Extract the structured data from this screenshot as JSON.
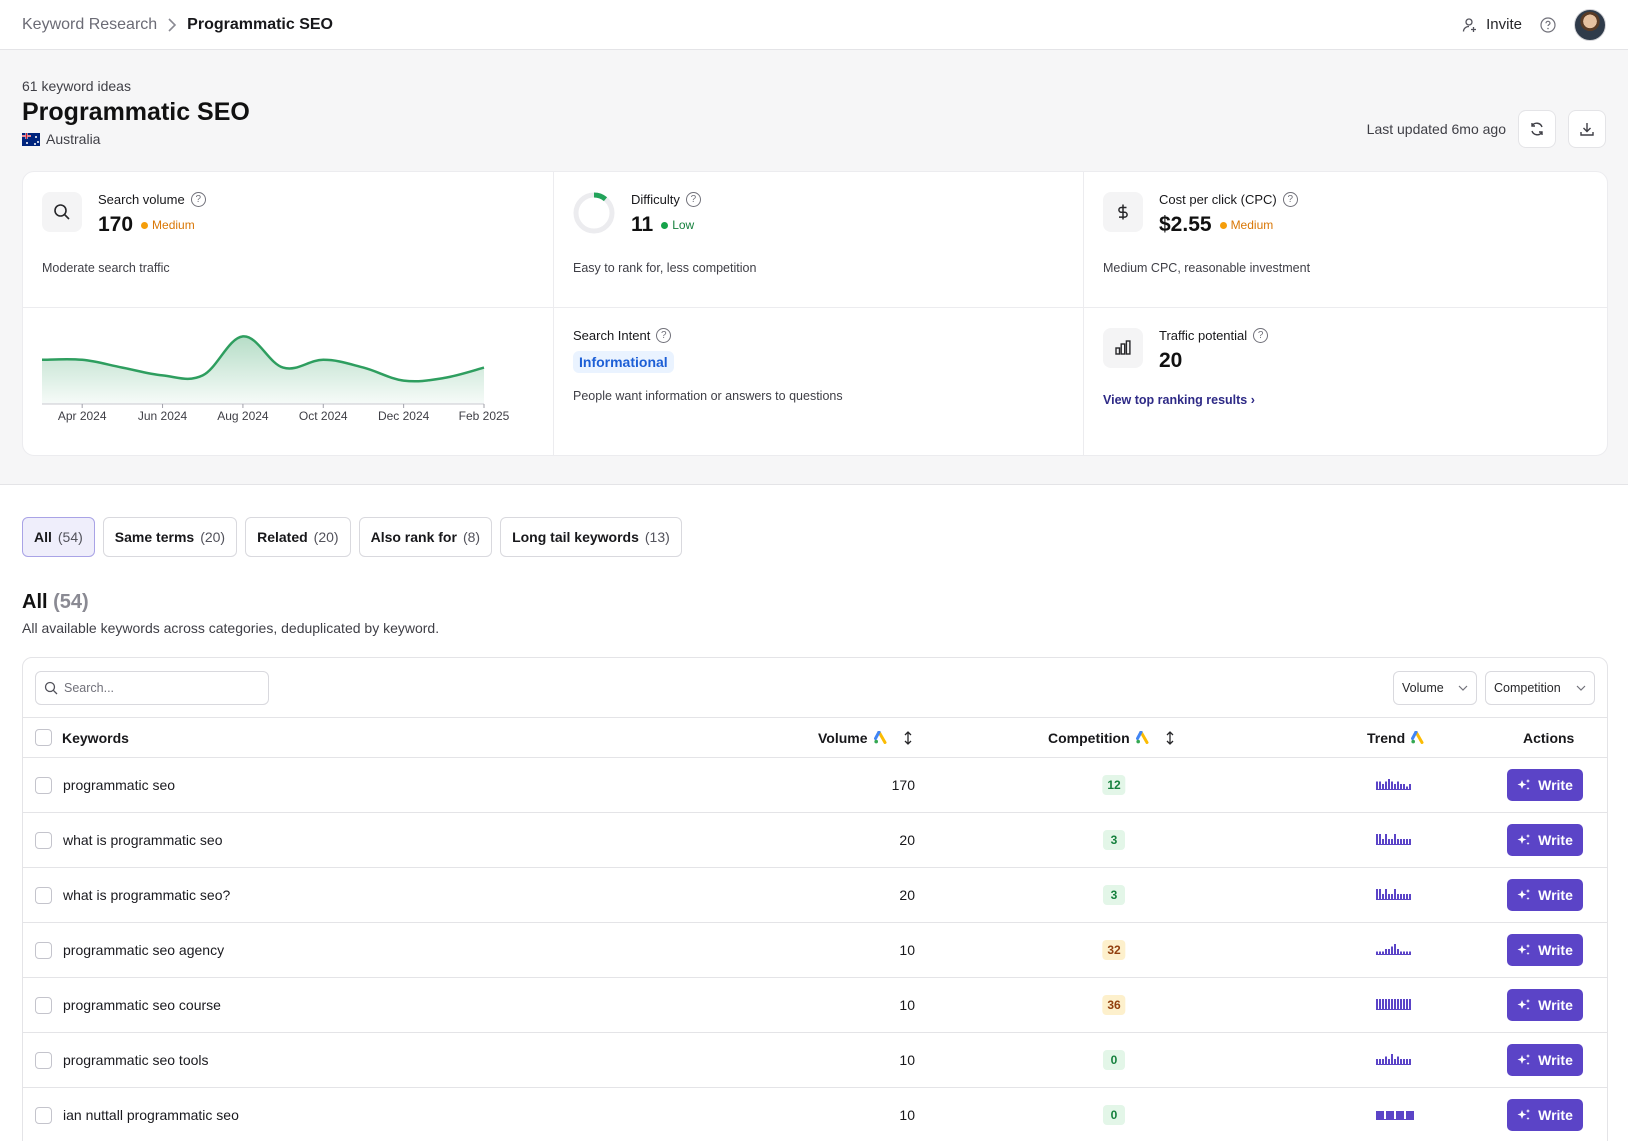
{
  "breadcrumb": {
    "parent": "Keyword Research",
    "current": "Programmatic SEO"
  },
  "topbar": {
    "invite_label": "Invite"
  },
  "header": {
    "idea_count": "61 keyword ideas",
    "title": "Programmatic SEO",
    "country": "Australia",
    "last_updated": "Last updated 6mo ago"
  },
  "metrics": {
    "search_volume": {
      "label": "Search volume",
      "value": "170",
      "level": "Medium",
      "desc": "Moderate search traffic"
    },
    "difficulty": {
      "label": "Difficulty",
      "value": "11",
      "level": "Low",
      "desc": "Easy to rank for, less competition",
      "percent": 11
    },
    "cpc": {
      "label": "Cost per click (CPC)",
      "value": "$2.55",
      "level": "Medium",
      "desc": "Medium CPC, reasonable investment"
    },
    "intent": {
      "label": "Search Intent",
      "value": "Informational",
      "desc": "People want information or answers to questions"
    },
    "traffic": {
      "label": "Traffic potential",
      "value": "20",
      "link": "View top ranking results"
    }
  },
  "chart_data": {
    "type": "area",
    "x": [
      "Mar 2024",
      "Apr 2024",
      "May 2024",
      "Jun 2024",
      "Jul 2024",
      "Aug 2024",
      "Sep 2024",
      "Oct 2024",
      "Nov 2024",
      "Dec 2024",
      "Jan 2025",
      "Feb 2025"
    ],
    "x_tick_labels": [
      "Apr 2024",
      "Jun 2024",
      "Aug 2024",
      "Oct 2024",
      "Dec 2024",
      "Feb 2025"
    ],
    "values": [
      170,
      170,
      140,
      110,
      110,
      260,
      140,
      170,
      140,
      90,
      100,
      140
    ],
    "ylim": [
      0,
      300
    ],
    "grid": false,
    "colors": {
      "line": "#2e9e5f",
      "fill": "#2e9e5f"
    }
  },
  "tabs": [
    {
      "name": "All",
      "count": "(54)",
      "active": true
    },
    {
      "name": "Same terms",
      "count": "(20)",
      "active": false
    },
    {
      "name": "Related",
      "count": "(20)",
      "active": false
    },
    {
      "name": "Also rank for",
      "count": "(8)",
      "active": false
    },
    {
      "name": "Long tail keywords",
      "count": "(13)",
      "active": false
    }
  ],
  "section": {
    "title": "All",
    "count": "(54)",
    "subtitle": "All available keywords across categories, deduplicated by keyword."
  },
  "table": {
    "search_placeholder": "Search...",
    "filters": [
      "Volume",
      "Competition"
    ],
    "headers": {
      "keywords": "Keywords",
      "volume": "Volume",
      "competition": "Competition",
      "trend": "Trend",
      "actions": "Actions"
    },
    "write_label": "Write",
    "rows": [
      {
        "keyword": "programmatic seo",
        "volume": "170",
        "competition": "12",
        "comp_level": "green",
        "trend": [
          3,
          3,
          2,
          3,
          4,
          3,
          2,
          3,
          2,
          2,
          1,
          2
        ]
      },
      {
        "keyword": "what is programmatic seo",
        "volume": "20",
        "competition": "3",
        "comp_level": "green",
        "trend": [
          4,
          4,
          2,
          4,
          2,
          2,
          4,
          2,
          2,
          2,
          2,
          2
        ]
      },
      {
        "keyword": "what is programmatic seo?",
        "volume": "20",
        "competition": "3",
        "comp_level": "green",
        "trend": [
          4,
          4,
          2,
          4,
          2,
          2,
          4,
          2,
          2,
          2,
          2,
          2
        ]
      },
      {
        "keyword": "programmatic seo agency",
        "volume": "10",
        "competition": "32",
        "comp_level": "amber",
        "trend": [
          1,
          1,
          1,
          2,
          2,
          3,
          4,
          2,
          1,
          1,
          1,
          1
        ]
      },
      {
        "keyword": "programmatic seo course",
        "volume": "10",
        "competition": "36",
        "comp_level": "amber",
        "trend": [
          4,
          4,
          4,
          4,
          4,
          4,
          4,
          4,
          4,
          4,
          4,
          4
        ]
      },
      {
        "keyword": "programmatic seo tools",
        "volume": "10",
        "competition": "0",
        "comp_level": "green",
        "trend": [
          2,
          2,
          2,
          3,
          2,
          4,
          2,
          3,
          2,
          2,
          2,
          2
        ]
      },
      {
        "keyword": "ian nuttall programmatic seo",
        "volume": "10",
        "competition": "0",
        "comp_level": "green",
        "trend": [
          4,
          4,
          4,
          4
        ]
      }
    ]
  }
}
